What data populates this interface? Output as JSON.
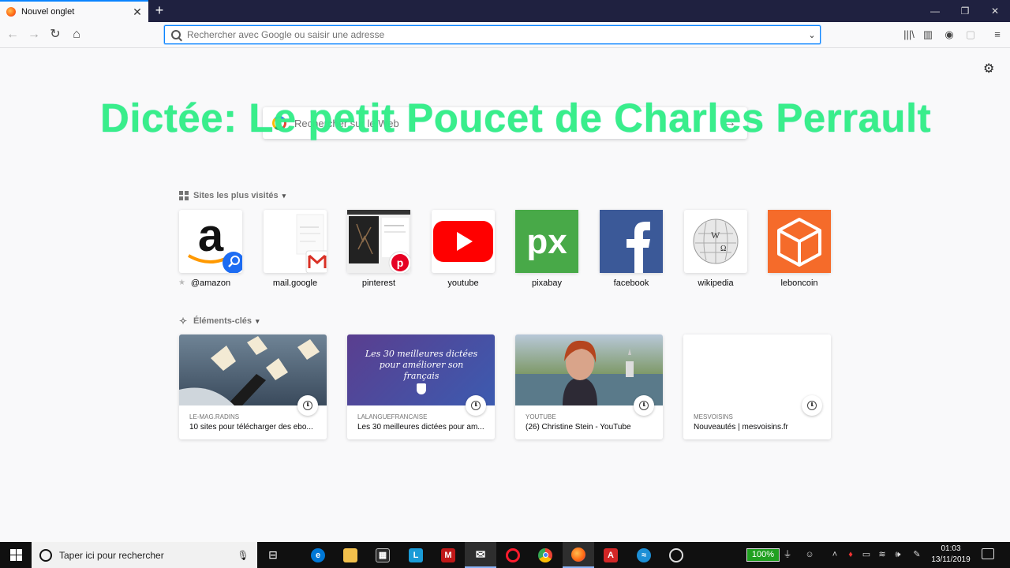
{
  "browser": {
    "tab_title": "Nouvel onglet",
    "new_tab_symbol": "+",
    "url_placeholder": "Rechercher avec Google ou saisir une adresse"
  },
  "overlay": {
    "title": "Dictée: Le petit Poucet de Charles Perrault",
    "color": "#33ee88"
  },
  "newtab": {
    "search_placeholder": "Rechercher sur le Web",
    "topsites_heading": "Sites les plus visités",
    "highlights_heading": "Éléments-clés",
    "topsites": [
      {
        "label": "@amazon",
        "icon": "amazon-icon",
        "pinned": true
      },
      {
        "label": "mail.google",
        "icon": "gmail-icon"
      },
      {
        "label": "pinterest",
        "icon": "pinterest-icon"
      },
      {
        "label": "youtube",
        "icon": "youtube-icon",
        "color": "#ff0000"
      },
      {
        "label": "pixabay",
        "icon": "pixabay-icon",
        "color": "#48a948"
      },
      {
        "label": "facebook",
        "icon": "facebook-icon",
        "color": "#3b5998"
      },
      {
        "label": "wikipedia",
        "icon": "wikipedia-icon"
      },
      {
        "label": "leboncoin",
        "icon": "leboncoin-icon",
        "color": "#f56b2a"
      }
    ],
    "highlights": [
      {
        "source": "LE-MAG.RADINS",
        "title": "10 sites pour télécharger des ebo..."
      },
      {
        "source": "LALANGUEFRANCAISE",
        "title": "Les 30 meilleures dictées pour am...",
        "image_text": "Les 30 meilleures dictées pour améliorer son français"
      },
      {
        "source": "YOUTUBE",
        "title": "(26) Christine Stein - YouTube"
      },
      {
        "source": "MESVOISINS",
        "title": "Nouveautés | mesvoisins.fr"
      }
    ]
  },
  "taskbar": {
    "search_placeholder": "Taper ici pour rechercher",
    "battery": "100%",
    "time": "01:03",
    "date": "13/11/2019"
  }
}
